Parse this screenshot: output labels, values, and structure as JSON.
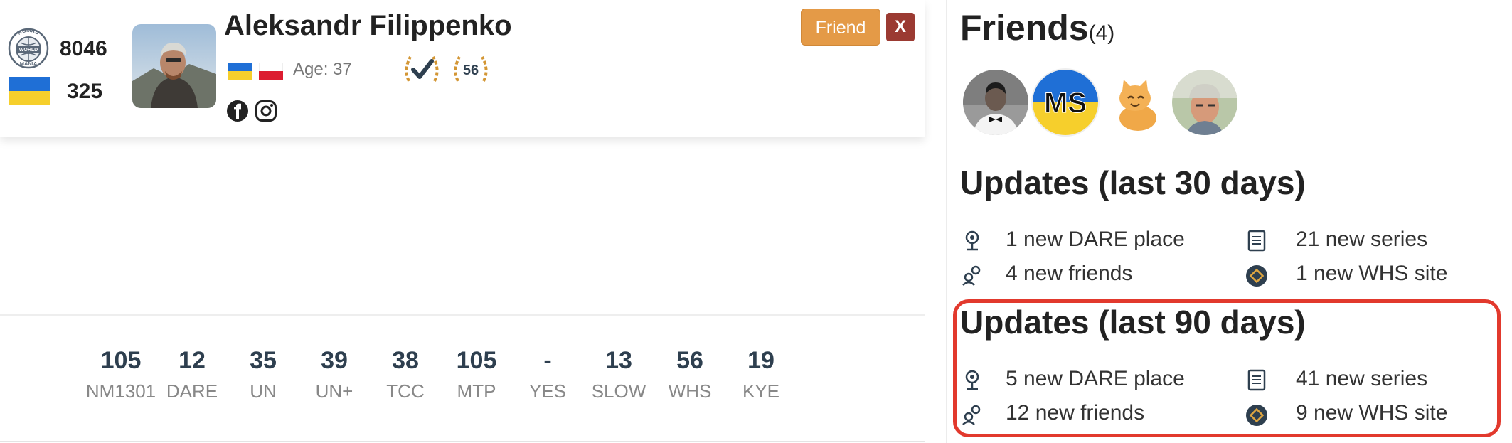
{
  "profile": {
    "name": "Aleksandr Filippenko",
    "logo_text": [
      "NOMAD",
      "WORLD",
      "MANIA"
    ],
    "score": "8046",
    "rank": "325",
    "age": "Age: 37",
    "badge_number": "56",
    "flags": [
      "ukraine-flag",
      "poland-flag"
    ],
    "social_icons": [
      "facebook-icon",
      "instagram-icon"
    ],
    "friend_button": "Friend",
    "close_button": "X",
    "colors": {
      "friend_btn": "#e49a47",
      "close_btn": "#9b3a32",
      "badge_gold": "#d39634"
    }
  },
  "stats": [
    {
      "value": "105",
      "label": "NM1301"
    },
    {
      "value": "12",
      "label": "DARE"
    },
    {
      "value": "35",
      "label": "UN"
    },
    {
      "value": "39",
      "label": "UN+"
    },
    {
      "value": "38",
      "label": "TCC"
    },
    {
      "value": "105",
      "label": "MTP"
    },
    {
      "value": "-",
      "label": "YES"
    },
    {
      "value": "13",
      "label": "SLOW"
    },
    {
      "value": "56",
      "label": "WHS"
    },
    {
      "value": "19",
      "label": "KYE"
    }
  ],
  "friends": {
    "title": "Friends",
    "count": "(4)",
    "avatars": [
      {
        "name": "friend-avatar-bowtie"
      },
      {
        "name": "friend-avatar-ms",
        "initials": "MS"
      },
      {
        "name": "friend-avatar-cat"
      },
      {
        "name": "friend-avatar-cap"
      }
    ]
  },
  "updates_30": {
    "title": "Updates (last 30 days)",
    "items": [
      {
        "icon": "dare-pin-icon",
        "text": "1 new DARE place"
      },
      {
        "icon": "series-list-icon",
        "text": "21 new series"
      },
      {
        "icon": "friends-icon",
        "text": "4 new friends"
      },
      {
        "icon": "whs-badge-icon",
        "text": "1 new WHS site"
      }
    ]
  },
  "updates_90": {
    "title": "Updates (last 90 days)",
    "items": [
      {
        "icon": "dare-pin-icon",
        "text": "5 new DARE place"
      },
      {
        "icon": "series-list-icon",
        "text": "41 new series"
      },
      {
        "icon": "friends-icon",
        "text": "12 new friends"
      },
      {
        "icon": "whs-badge-icon",
        "text": "9 new WHS site"
      }
    ],
    "highlight_color": "#e2392d"
  }
}
